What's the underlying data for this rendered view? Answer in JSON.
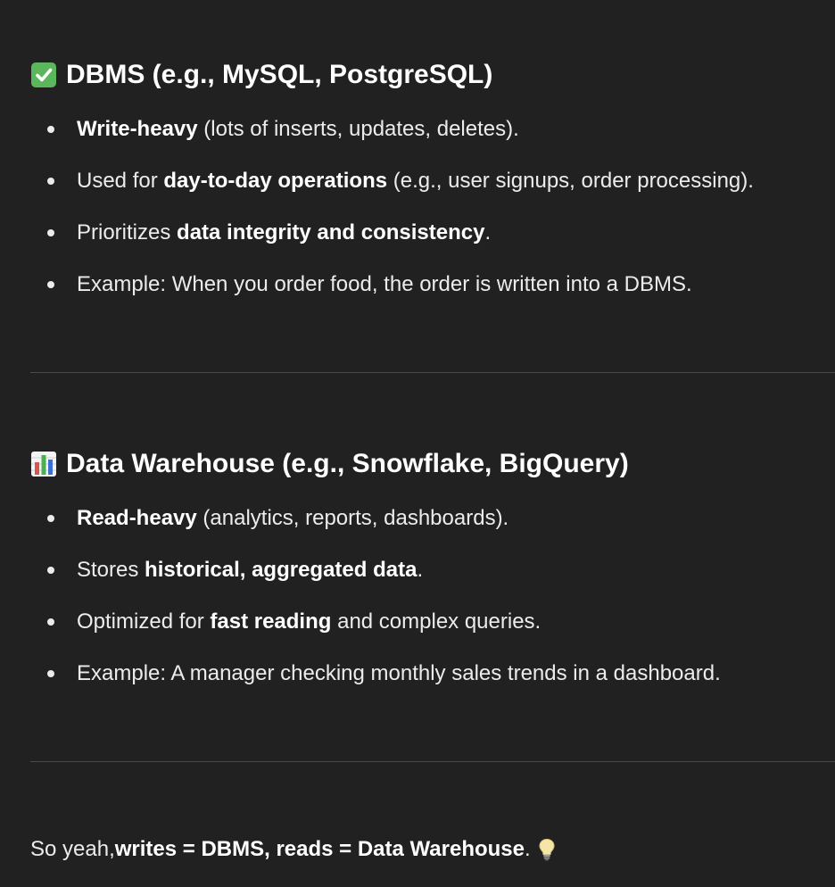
{
  "sections": [
    {
      "icon": "check-mark-button-icon",
      "heading": "DBMS (e.g., MySQL, PostgreSQL)",
      "bullets": [
        {
          "bold": "Write-heavy",
          "rest": " (lots of inserts, updates, deletes)."
        },
        {
          "before": "Used for ",
          "bold": "day-to-day operations",
          "rest": " (e.g., user signups, order processing)."
        },
        {
          "before": "Prioritizes ",
          "bold": "data integrity and consistency",
          "rest": "."
        },
        {
          "text": "Example: When you order food, the order is written into a DBMS."
        }
      ]
    },
    {
      "icon": "bar-chart-icon",
      "heading": "Data Warehouse (e.g., Snowflake, BigQuery)",
      "bullets": [
        {
          "bold": "Read-heavy",
          "rest": " (analytics, reports, dashboards)."
        },
        {
          "before": "Stores ",
          "bold": "historical, aggregated data",
          "rest": "."
        },
        {
          "before": "Optimized for ",
          "bold": "fast reading",
          "rest": " and complex queries."
        },
        {
          "text": "Example: A manager checking monthly sales trends in a dashboard."
        }
      ]
    }
  ],
  "summary": {
    "before": "So yeah, ",
    "bold": "writes = DBMS, reads = Data Warehouse",
    "after": ".",
    "icon": "light-bulb-icon"
  },
  "colors": {
    "background": "#212121",
    "text": "#ececec",
    "divider": "#4a4a4a",
    "check_green": "#5bb75b",
    "chart_blue": "#3b6fd1",
    "chart_green": "#4caf50",
    "chart_red": "#d9534f"
  }
}
